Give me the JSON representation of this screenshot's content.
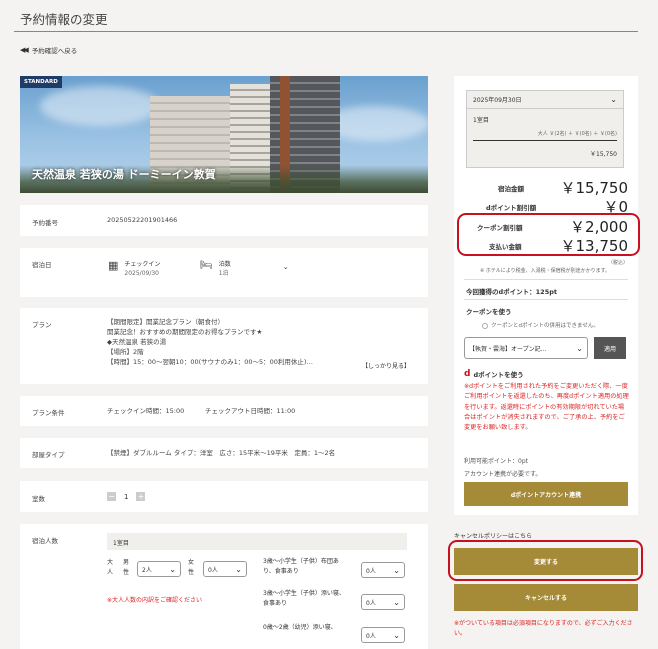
{
  "page": {
    "title": "予約情報の変更",
    "back_label": "予約確認へ戻る"
  },
  "hotel": {
    "badge": "STANDARD",
    "name": "天然温泉 若狭の湯 ドーミーイン敦賀"
  },
  "reservation": {
    "number_label": "予約番号",
    "number": "20250522201901466",
    "stay_label": "宿泊日",
    "checkin_label": "チェックイン",
    "checkin_date": "2025/09/30",
    "nights_label": "泊数",
    "nights_value": "1泊",
    "plan_label": "プラン",
    "plan_lines": [
      "【期間限定】開業記念プラン（朝食付）",
      "開業記念！おすすめの期間限定のお得なプランです★",
      "◆天然温泉 若狭の湯",
      "【場所】2階",
      "【時間】15：00～翌朝10：00(サウナのみ1：00～5：00利用休止)…"
    ],
    "plan_more": "【しっかり見る】",
    "conditions_label": "プラン条件",
    "checkin_time": "チェックイン時間：15:00",
    "checkout_time": "チェックアウト日時間：11:00",
    "room_label": "部屋タイプ",
    "room_value": "【禁煙】ダブルルーム タイプ：洋室　広さ：15平米～19平米　定員：1～2名",
    "count_label": "室数",
    "count_value": "1",
    "guests_label": "宿泊人数",
    "room_header": "1室目",
    "adult_label": "大人",
    "male_label": "男性",
    "female_label": "女性",
    "male_value": "2人",
    "female_value": "0人",
    "adult_warning": "※大人人数の内訳をご確認ください",
    "child1_label": "3歳～小学生（子供）布団あり、食事あり",
    "child2_label": "3歳～小学生（子供）添い寝、食事あり",
    "child3_label": "0歳～2歳（幼児）添い寝、",
    "child_value": "0人"
  },
  "summary": {
    "date": "2025年09月30日",
    "room": "1室目",
    "breakdown": "大人 ￥(2名) ＋ ￥(0名) ＋ ￥(0名)",
    "room_price": "￥15,750",
    "stay_total_label": "宿泊金額",
    "stay_total": "￥15,750",
    "d_discount_label": "dポイント割引額",
    "d_discount": "￥0",
    "coupon_label": "クーポン割引額",
    "coupon_value": "￥2,000",
    "pay_label": "支払い金額",
    "pay_value": "￥13,750",
    "tax_note": "（税込）",
    "note": "※ ホテルにより税金、入湯税・保宿税が別途かかります。",
    "points_earn": "今回獲得のdポイント：125pt",
    "coupon_use_label": "クーポンを使う",
    "coupon_radio_note": "クーポンとdポイントの併用はできません。",
    "coupon_select": "【執賀・雲海】オープン記…",
    "apply_label": "適用",
    "d_use_label": "dポイントを使う",
    "d_warning": "※dポイントをご利用された予約をご変更いただく際、一度ご利用ポイントを返還したのち、再度dポイント適用の処理を行います。返還時にポイントの有効期限が切れていた場合はポイントが消失されますので、ご了承の上、予約をご変更をお願い致します。",
    "d_available": "利用可能ポイント：0pt",
    "d_account_note": "アカウント連携が必要です。",
    "d_link_button": "dポイントアカウント連携",
    "cancel_policy": "キャンセルポリシーはこちら",
    "change_button": "変更する",
    "cancel_button": "キャンセルする",
    "required_note": "※がついている項目は必須項目になりますので、必ずご入力ください。"
  },
  "colors": {
    "accent_gold": "#a58a38",
    "highlight_red": "#c8101e",
    "badge_navy": "#1f3c67"
  }
}
